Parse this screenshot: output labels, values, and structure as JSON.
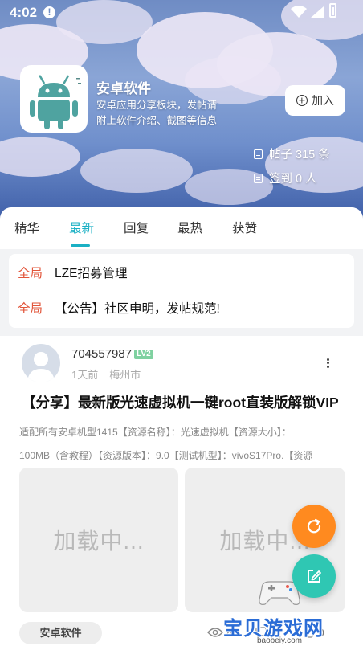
{
  "status_bar": {
    "time": "4:02",
    "alert_glyph": "!"
  },
  "forum": {
    "name": "安卓软件",
    "description": "安卓应用分享板块，发帖请附上软件介绍、截图等信息",
    "join_label": "加入",
    "posts_stat": "帖子 315 条",
    "signin_stat": "签到 0 人"
  },
  "tabs": [
    {
      "label": "精华",
      "active": false
    },
    {
      "label": "最新",
      "active": true
    },
    {
      "label": "回复",
      "active": false
    },
    {
      "label": "最热",
      "active": false
    },
    {
      "label": "获赞",
      "active": false
    }
  ],
  "pinned": [
    {
      "tag": "全局",
      "text": "LZE招募管理"
    },
    {
      "tag": "全局",
      "text": "【公告】社区申明，发帖规范!"
    }
  ],
  "post": {
    "username": "704557987",
    "level": "LV2",
    "time": "1天前",
    "location": "梅州市",
    "title": "【分享】最新版光速虚拟机一键root直装版解锁VIP",
    "body_line1": "适配所有安卓机型1415【资源名称】：光速虚拟机【资源大小】：",
    "body_line2": "100MB（含教程）【资源版本】：9.0【测试机型】：vivoS17Pro.【资源",
    "image_loading_1": "加载中...",
    "image_loading_2": "加载中...",
    "category": "安卓软件",
    "views": "4",
    "comments": "0",
    "likes": "0"
  },
  "watermark": {
    "text": "宝贝游戏网",
    "url": "baobeiy.com"
  },
  "icons": {
    "more": "more-vertical-icon",
    "refresh": "refresh-icon",
    "edit": "edit-icon",
    "view": "eye-icon"
  },
  "colors": {
    "accent": "#1ab0c4",
    "pinned_tag": "#e2553a",
    "fab_refresh": "#ff8a1f",
    "fab_edit": "#2fc7b3",
    "level_badge": "#7fd1a0"
  }
}
